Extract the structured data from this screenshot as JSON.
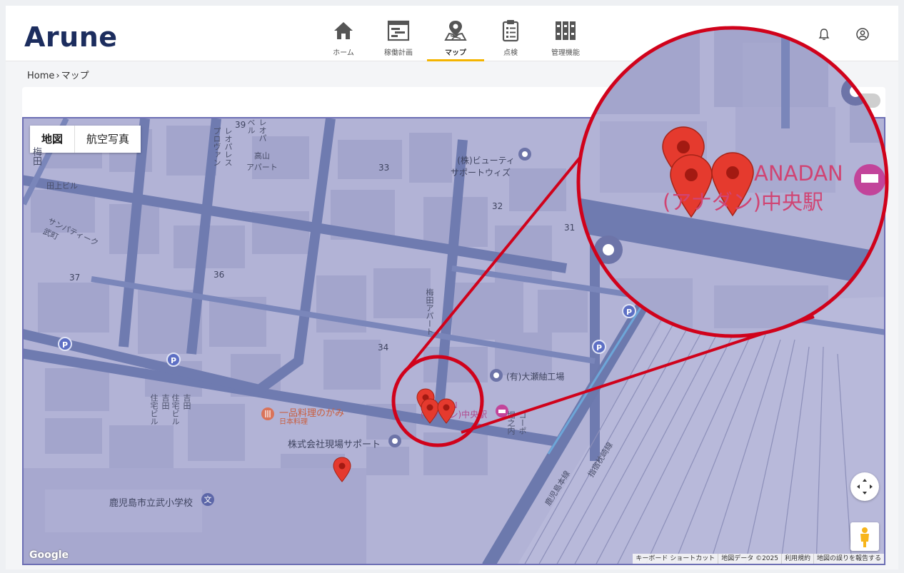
{
  "app": {
    "logo": "Arune"
  },
  "nav": {
    "items": [
      {
        "label": "ホーム",
        "icon": "home-icon"
      },
      {
        "label": "稼働計画",
        "icon": "schedule-icon"
      },
      {
        "label": "マップ",
        "icon": "map-pin-icon",
        "active": true
      },
      {
        "label": "点検",
        "icon": "clipboard-icon"
      },
      {
        "label": "管理機能",
        "icon": "binders-icon"
      }
    ],
    "active_color": "#f4b400"
  },
  "header_icons": [
    "bell-icon",
    "user-icon"
  ],
  "breadcrumb": {
    "home": "Home",
    "separator": "›",
    "current": "マップ"
  },
  "map": {
    "type_controls": {
      "map": "地図",
      "satellite": "航空写真"
    },
    "block_numbers": [
      "39",
      "33",
      "32",
      "31",
      "37",
      "36",
      "34"
    ],
    "labels": {
      "road_name": "梅田",
      "taue_building": "田上ビル",
      "sanpatique": "サンパティーク\n武町",
      "leopalace_1": "レオパレス\nプロヴァン",
      "leopalace_2": "レオパ\nベル",
      "takayama_apart": "高山\nアパート",
      "umeda_apart": "梅田アパート",
      "yoshida_1": "吉田\n住宅ビル",
      "yoshida_2": "吉田\n住宅ビル",
      "kopo": "コーポ\n堀之内",
      "kagoshima_line": "鹿児島本線",
      "ibusuki_line": "指宿枕崎線"
    },
    "pois": {
      "beauty": "(株)ビューティ\nサポートウィズ",
      "oose": "(有)大瀬紬工場",
      "restaurant": "一品料理のがみ",
      "restaurant_sub": "日本料理",
      "genba": "株式会社現場サポート",
      "school": "鹿児島市立武小学校",
      "hotel_small": "ANADAN\n(アナダン)中央駅"
    },
    "parking_label": "P",
    "attribution": {
      "logo": "Google",
      "shortcuts": "キーボード ショートカット",
      "map_data": "地図データ ©2025",
      "terms": "利用規約",
      "report": "地図の誤りを報告する"
    },
    "zoom_callout": {
      "text_line1": "ANADAN",
      "text_line2": "(アナダン)中央駅",
      "ring_color": "#d0021b"
    },
    "marker_color": "#e53a2e",
    "tint_color": "#b2b3d6"
  }
}
